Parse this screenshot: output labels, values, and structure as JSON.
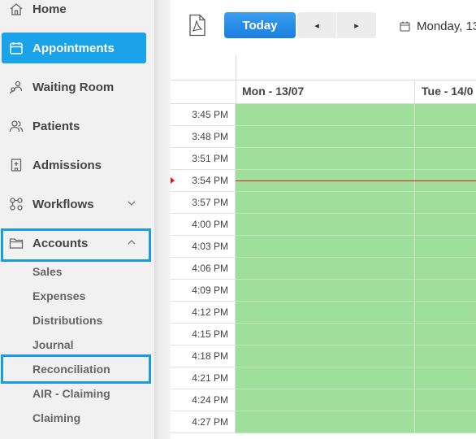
{
  "sidebar": {
    "items": [
      {
        "label": "Home",
        "icon": "home-icon"
      },
      {
        "label": "Appointments",
        "icon": "calendar-icon",
        "active": true
      },
      {
        "label": "Waiting Room",
        "icon": "waiting-room-icon"
      },
      {
        "label": "Patients",
        "icon": "patients-icon"
      },
      {
        "label": "Admissions",
        "icon": "hospital-icon"
      },
      {
        "label": "Workflows",
        "icon": "workflow-icon"
      },
      {
        "label": "Accounts",
        "icon": "folder-icon",
        "expanded": true
      }
    ],
    "accounts_submenu": [
      "Sales",
      "Expenses",
      "Distributions",
      "Journal",
      "Reconciliation",
      "AIR - Claiming",
      "Claiming"
    ]
  },
  "toolbar": {
    "today_label": "Today",
    "prev_label": "◂",
    "next_label": "▸",
    "date_range": "Monday, 13"
  },
  "calendar": {
    "days": [
      "Mon - 13/07",
      "Tue - 14/0"
    ],
    "times": [
      "3:45 PM",
      "3:48 PM",
      "3:51 PM",
      "3:54 PM",
      "3:57 PM",
      "4:00 PM",
      "4:03 PM",
      "4:06 PM",
      "4:09 PM",
      "4:12 PM",
      "4:15 PM",
      "4:18 PM",
      "4:21 PM",
      "4:24 PM",
      "4:27 PM"
    ]
  },
  "colors": {
    "accent": "#1aa3e8",
    "highlight_border": "#1a9be8",
    "today_button": "#1a86e8",
    "available_slot": "#9fdf9b",
    "now_line": "#d81b1b"
  }
}
